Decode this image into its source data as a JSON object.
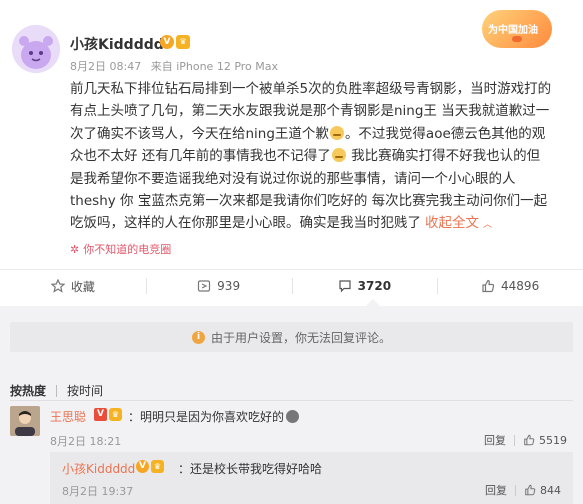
{
  "post": {
    "username": "小孩Kiddddd",
    "time": "8月2日 08:47",
    "source": "来自 iPhone 12 Pro Max",
    "badge_text": "为中国加油",
    "lines": [
      "前几天私下排位钻石局排到一个被单杀5次的负胜率超级号青钢影，当时游戏打的",
      "有点上头喷了几句，第二天水友跟我说是那个青钢影是ning王 当天我就道歉过一",
      "次了确实不该骂人，今天在给ning王道个歉",
      "。不过我觉得aoe德云色其他的观",
      "众也不太好 还有几年前的事情我也不记得了",
      " 我比赛确实打得不好我也认的但",
      "是我希望你不要造谣我绝对没有说过你说的那些事情，请问一个小心眼的人",
      "theshy 你 宝蓝杰克第一次来都是我请你们吃好的 每次比赛完我主动问你们一起",
      "吃饭吗，这样的人在你那里是小心眼。确实是我当时犯贱了"
    ],
    "collapse_label": "收起全文",
    "topic": "你不知道的电竞圈"
  },
  "actions": {
    "favorite": "收藏",
    "repost": "939",
    "comment": "3720",
    "like": "44896"
  },
  "comments": {
    "notice": "由于用户设置，你无法回复评论。",
    "sort_hot": "按热度",
    "sort_time": "按时间",
    "items": [
      {
        "name": "王思聪",
        "text": "：明明只是因为你喜欢吃好的",
        "time": "8月2日 18:21",
        "reply_label": "回复",
        "likes": "5519"
      }
    ],
    "reply": {
      "name": "小孩Kiddddd",
      "text": "：还是校长带我吃得好哈哈",
      "time": "8月2日 19:37",
      "reply_label": "回复",
      "likes": "844"
    }
  },
  "colors": {
    "accent": "#eb7350",
    "topic": "#e2586b",
    "comment_bg": "#f2f2f5"
  }
}
